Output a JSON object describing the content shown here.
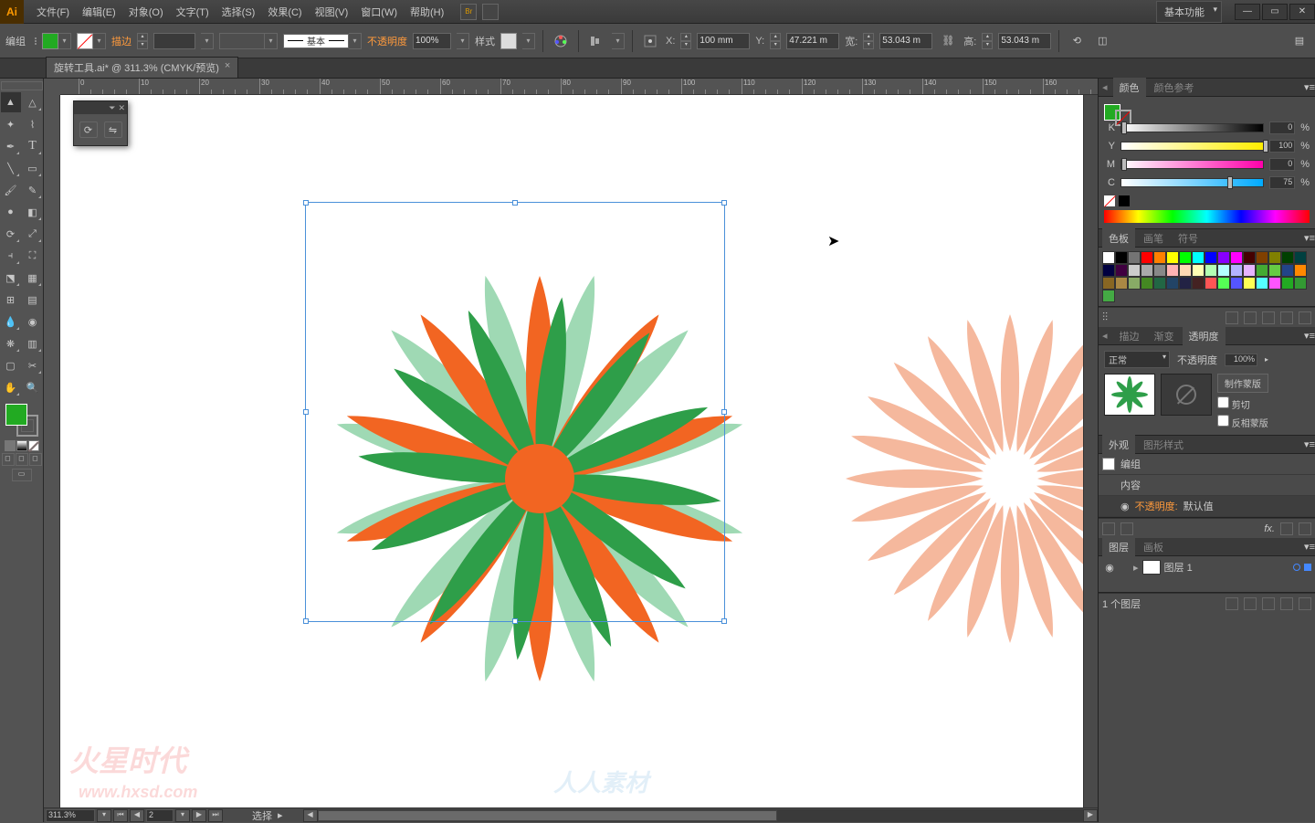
{
  "app": {
    "logo": "Ai"
  },
  "menu": [
    "文件(F)",
    "编辑(E)",
    "对象(O)",
    "文字(T)",
    "选择(S)",
    "效果(C)",
    "视图(V)",
    "窗口(W)",
    "帮助(H)"
  ],
  "workspace": "基本功能",
  "optbar": {
    "group_label": "编组",
    "stroke_label": "描边",
    "style_basic": "基本",
    "opacity_label": "不透明度",
    "opacity_val": "100%",
    "style_label": "样式",
    "x_label": "X:",
    "x_val": "100 mm",
    "y_label": "Y:",
    "y_val": "47.221 m",
    "w_label": "宽:",
    "w_val": "53.043 m",
    "h_label": "高:",
    "h_val": "53.043 m"
  },
  "doc_tab": {
    "name": "旋转工具.ai* @ 311.3% (CMYK/预览)",
    "close": "×"
  },
  "ruler_marks": [
    0,
    10,
    20,
    30,
    40,
    50,
    60,
    70,
    80,
    90,
    100,
    110,
    120,
    130,
    140,
    150,
    160
  ],
  "status": {
    "zoom": "311.3%",
    "pager_val": "2",
    "tool": "选择"
  },
  "panels": {
    "color": {
      "tabs": [
        "颜色",
        "颜色参考"
      ],
      "sliders": [
        {
          "lbl": "C",
          "val": "75",
          "bg": "linear-gradient(90deg,#fff,#0af)",
          "knob": 75
        },
        {
          "lbl": "M",
          "val": "0",
          "bg": "linear-gradient(90deg,#fff,#f0a)",
          "knob": 0
        },
        {
          "lbl": "Y",
          "val": "100",
          "bg": "linear-gradient(90deg,#fff,#fe0)",
          "knob": 100
        },
        {
          "lbl": "K",
          "val": "0",
          "bg": "linear-gradient(90deg,#fff,#000)",
          "knob": 0
        }
      ],
      "pct": "%"
    },
    "swatches": {
      "tabs": [
        "色板",
        "画笔",
        "符号"
      ],
      "colors": [
        "#fff",
        "#000",
        "#747474",
        "#f00",
        "#ff8000",
        "#ff0",
        "#0f0",
        "#0ff",
        "#00f",
        "#80f",
        "#f0f",
        "#400",
        "#804000",
        "#808000",
        "#004000",
        "#004040",
        "#000040",
        "#400040",
        "#ccc",
        "#aaa",
        "#888",
        "#ffb3b3",
        "#ffd9b3",
        "#ffffb3",
        "#b3ffb3",
        "#b3ffff",
        "#b3b3ff",
        "#e6b3ff",
        "#4a3",
        "#6c4",
        "#248",
        "#f80",
        "#862",
        "#a84",
        "#8a6",
        "#482",
        "#264",
        "#246",
        "#224",
        "#422",
        "#f55",
        "#5f5",
        "#55f",
        "#ff5",
        "#5ff",
        "#f5f",
        "#2a2",
        "#393",
        "#4a4"
      ]
    },
    "stroke_row": {
      "tabs": [
        "描边",
        "渐变",
        "透明度"
      ]
    },
    "transparency": {
      "mode": "正常",
      "opacity_label": "不透明度",
      "opacity_val": "100%",
      "make_mask": "制作蒙版",
      "clip": "剪切",
      "invert": "反相蒙版"
    },
    "appearance": {
      "tabs": [
        "外观",
        "图形样式"
      ],
      "group": "编组",
      "content": "内容",
      "opacity_row": "不透明度:",
      "opacity_val": "默认值"
    },
    "layers": {
      "tabs": [
        "图层",
        "画板"
      ],
      "layer_name": "图层 1",
      "footer": "1 个图层"
    }
  },
  "watermarks": {
    "hx": "火星时代",
    "hx_url": "www.hxsd.com",
    "rr": "人人素材"
  }
}
